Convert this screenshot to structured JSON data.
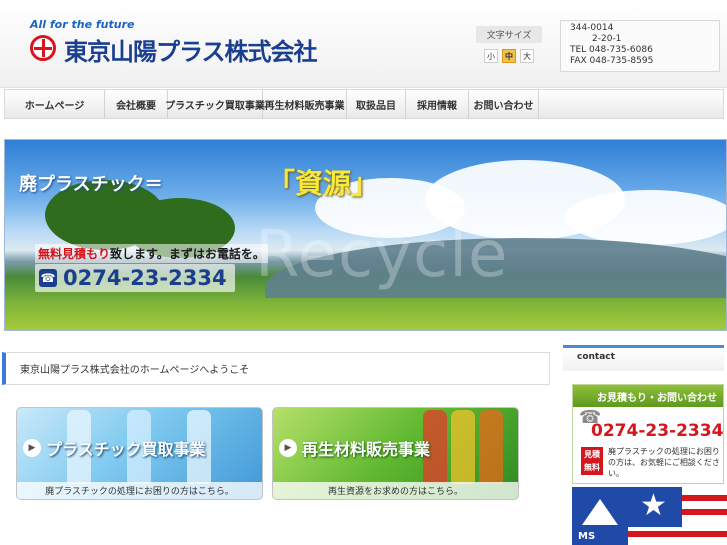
{
  "header": {
    "tagline": "All for the future",
    "company_name": "東京山陽プラス株式会社"
  },
  "font_size": {
    "label": "文字サイズ",
    "small": "小",
    "medium": "中",
    "large": "大",
    "selected": "中"
  },
  "address": {
    "postal": "344-0014",
    "street": "2-20-1",
    "tel": "TEL 048-735-6086",
    "fax": "FAX 048-735-8595"
  },
  "nav": {
    "items": [
      {
        "label": "ホームページ"
      },
      {
        "label": "会社概要"
      },
      {
        "label": "プラスチック買取事業"
      },
      {
        "label": "再生材料販売事業"
      },
      {
        "label": "取扱品目"
      },
      {
        "label": "採用情報"
      },
      {
        "label": "お問い合わせ"
      }
    ]
  },
  "hero": {
    "title": "廃プラスチック＝",
    "highlight": "「資源」",
    "estimate_red": "無料見積もり",
    "estimate_rest": "致します。まずはお電話を。",
    "phone": "0274-23-2334",
    "watermark": "Recycle"
  },
  "main": {
    "heading": "東京山陽プラス株式会社のホームページへようこそ"
  },
  "features": [
    {
      "title": "プラスチック買取事業",
      "caption": "廃プラスチックの処理にお困りの方はこちら。"
    },
    {
      "title": "再生材料販売事業",
      "caption": "再生資源をお求めの方はこちら。"
    }
  ],
  "sidebar": {
    "heading": "contact",
    "contact_title": "お見積もり・お問い合わせ",
    "contact_phone": "0274-23-2334",
    "badge": "見積\n無料",
    "note": "廃プラスチックの処理にお困りの方は、お気軽にご相談ください。",
    "cert_label": "MS"
  },
  "colors": {
    "brand_blue": "#1a3f8f",
    "accent_red": "#d4161e",
    "nav_border": "#d2d2d2",
    "highlight_yellow": "#f7e83a",
    "contact_green": "#5e9a1d"
  }
}
